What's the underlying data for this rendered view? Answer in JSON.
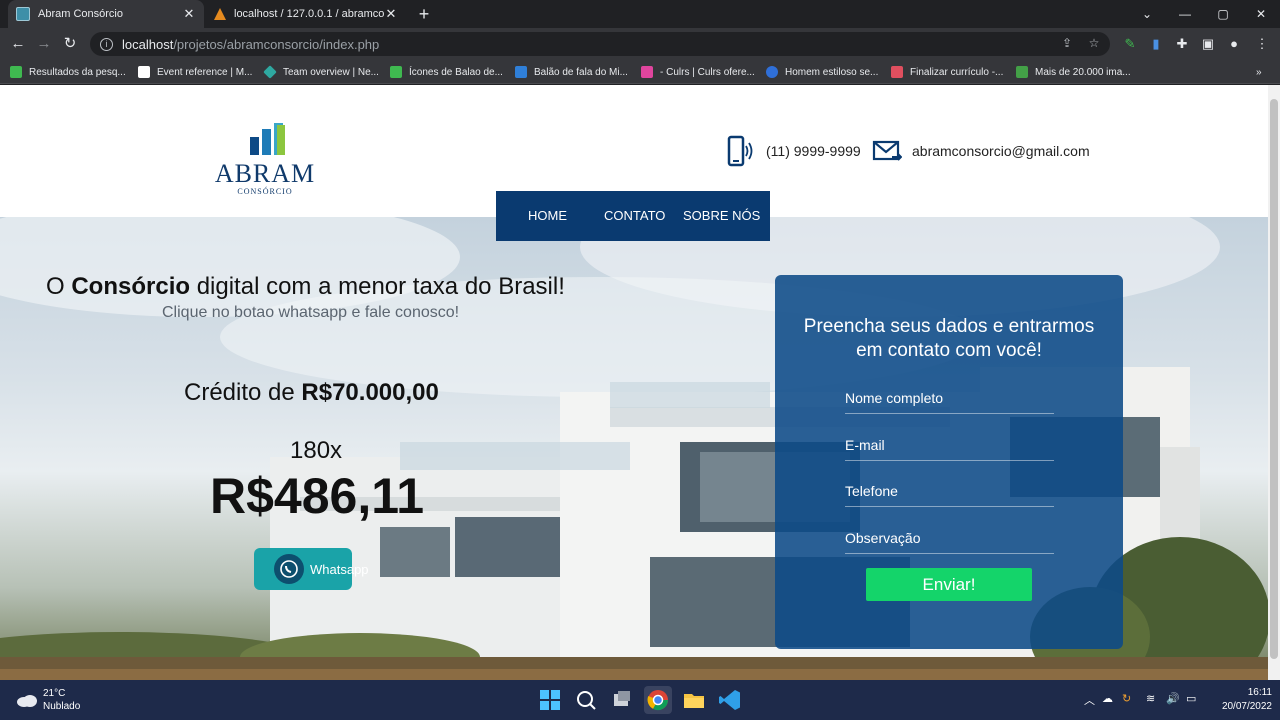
{
  "browser": {
    "tabs": [
      {
        "title": "Abram Consórcio",
        "active": true
      },
      {
        "title": "localhost / 127.0.0.1 / abramcons",
        "active": false
      }
    ],
    "address": {
      "host": "localhost",
      "path": "/projetos/abramconsorcio/index.php"
    },
    "bookmarks": [
      {
        "label": "Resultados da pesq...",
        "color": "#3fb950"
      },
      {
        "label": "Event reference | M...",
        "color": "#ffffff"
      },
      {
        "label": "Team overview | Ne...",
        "color": "#2ea8a0"
      },
      {
        "label": "Ícones de Balao de...",
        "color": "#3fb950"
      },
      {
        "label": "Balão de fala do Mi...",
        "color": "#2f7fd8"
      },
      {
        "label": "- Culrs | Culrs ofere...",
        "color": "#e0459e"
      },
      {
        "label": "Homem estiloso se...",
        "color": "#2f6fd8"
      },
      {
        "label": "Finalizar currículo -...",
        "color": "#e04f5f"
      },
      {
        "label": "Mais de 20.000 ima...",
        "color": "#43a047"
      }
    ],
    "bookmarks_more": "»"
  },
  "site": {
    "logo": {
      "word": "ABRAM",
      "sub": "CONSÓRCIO"
    },
    "phone": "(11) 9999-9999",
    "email": "abramconsorcio@gmail.com",
    "nav": [
      "HOME",
      "CONTATO",
      "SOBRE NÓS"
    ]
  },
  "hero": {
    "title_pre": "O ",
    "title_bold": "Consórcio",
    "title_post": " digital com a menor taxa do Brasil!",
    "subtitle": "Clique no botao whatsapp e fale conosco!",
    "credit_label": "Crédito de ",
    "credit_value": "R$70.000,00",
    "installments": "180x",
    "price": "R$486,11",
    "whatsapp_label": "Whatsapp"
  },
  "form": {
    "title_line1": "Preencha seus dados e entrarmos",
    "title_line2": "em contato com você!",
    "fields": [
      "Nome completo",
      "E-mail",
      "Telefone",
      "Observação"
    ],
    "submit_label": "Enviar!"
  },
  "taskbar": {
    "temperature": "21°C",
    "condition": "Nublado",
    "time": "16:11",
    "date": "20/07/2022"
  }
}
